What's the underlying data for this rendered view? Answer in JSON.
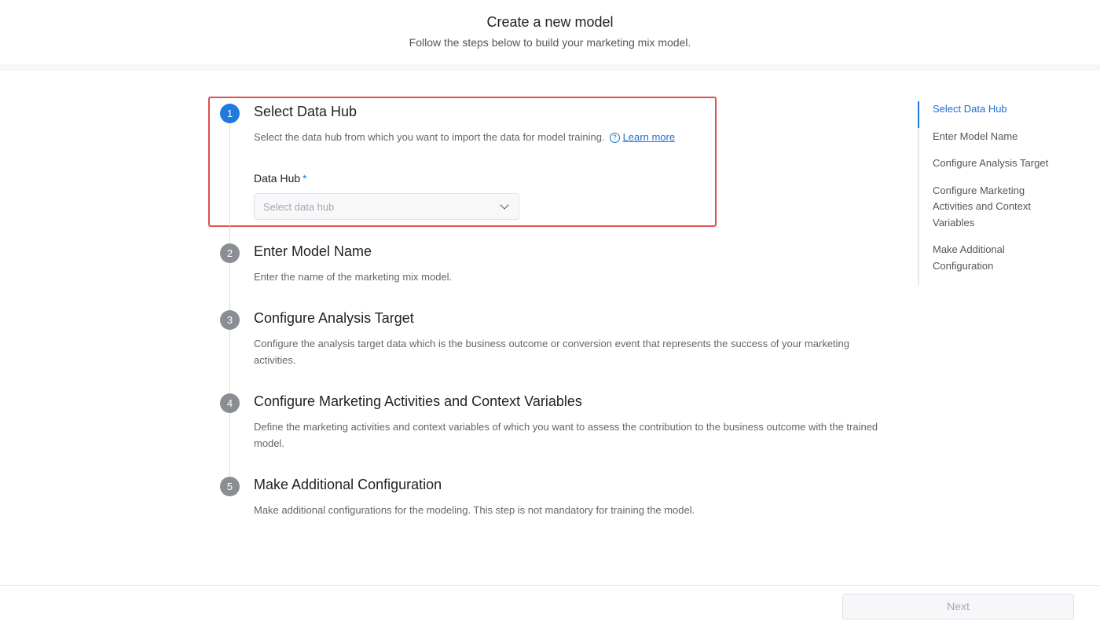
{
  "header": {
    "title": "Create a new model",
    "subtitle": "Follow the steps below to build your marketing mix model."
  },
  "steps": [
    {
      "number": "1",
      "title": "Select Data Hub",
      "description": "Select the data hub from which you want to import the data for model training.",
      "learn_more": "Learn more",
      "field_label": "Data Hub",
      "required_mark": "*",
      "select_placeholder": "Select data hub"
    },
    {
      "number": "2",
      "title": "Enter Model Name",
      "description": "Enter the name of the marketing mix model."
    },
    {
      "number": "3",
      "title": "Configure Analysis Target",
      "description": "Configure the analysis target data which is the business outcome or conversion event that represents the success of your marketing activities."
    },
    {
      "number": "4",
      "title": "Configure Marketing Activities and Context Variables",
      "description": "Define the marketing activities and context variables of which you want to assess the contribution to the business outcome with the trained model."
    },
    {
      "number": "5",
      "title": "Make Additional Configuration",
      "description": "Make additional configurations for the modeling. This step is not mandatory for training the model."
    }
  ],
  "toc": [
    "Select Data Hub",
    "Enter Model Name",
    "Configure Analysis Target",
    "Configure Marketing Activities and Context Variables",
    "Make Additional Configuration"
  ],
  "footer": {
    "next_label": "Next"
  },
  "colors": {
    "accent": "#1f7ae0",
    "highlight": "#e04f4f",
    "inactive_step": "#8a8d92"
  }
}
